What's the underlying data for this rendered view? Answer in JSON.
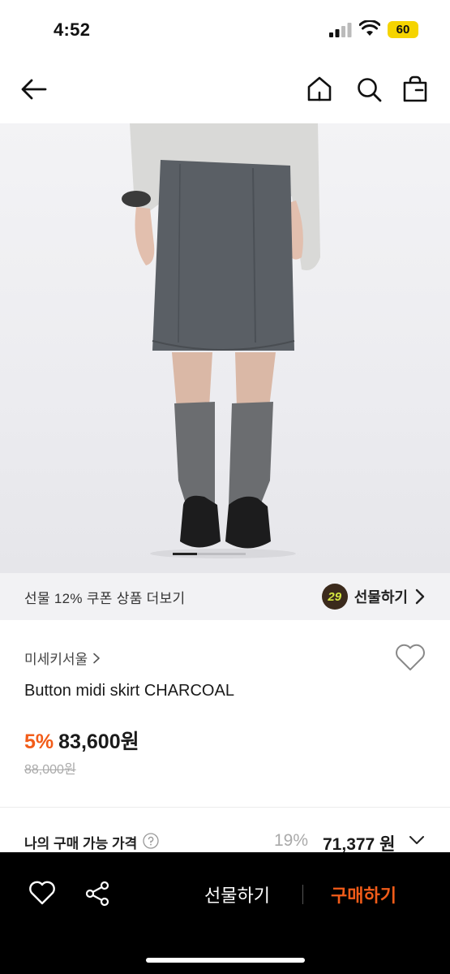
{
  "status_bar": {
    "time": "4:52",
    "battery": "60"
  },
  "nav": {
    "back_icon": "arrow-left-icon",
    "home_icon": "home-icon",
    "search_icon": "search-icon",
    "bag_icon": "shopping-bag-icon"
  },
  "product_image": {
    "pages": 3,
    "current_page": 1
  },
  "coupon_strip": {
    "text": "선물 12% 쿠폰 상품 더보기",
    "gift_count": "29",
    "gift_label": "선물하기"
  },
  "product": {
    "brand": "미세키서울",
    "title": "Button midi skirt CHARCOAL",
    "discount": "5%",
    "price": "83,600원",
    "original_price": "88,000원"
  },
  "my_price": {
    "label": "나의 구매 가능 가격",
    "discount": "19%",
    "price": "71,377 원"
  },
  "bottom_bar": {
    "gift_label": "선물하기",
    "buy_label": "구매하기"
  },
  "colors": {
    "accent": "#f25c19",
    "badge_bg": "#3b2a1c",
    "badge_fg": "#d4e640",
    "battery": "#f5d400"
  }
}
